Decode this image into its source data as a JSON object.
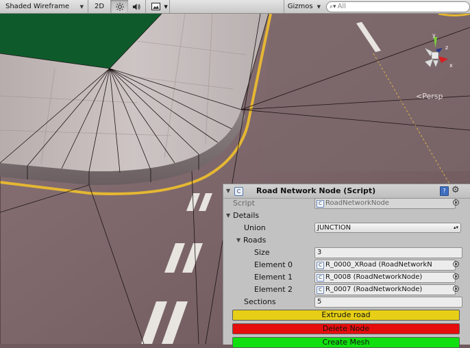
{
  "toolbar": {
    "shading_mode": "Shaded Wireframe",
    "two_d_label": "2D",
    "lighting_icon": "sun-icon",
    "audio_icon": "speaker-icon",
    "effects_icon": "image-icon",
    "gizmos_label": "Gizmos",
    "search_placeholder": "All"
  },
  "scene": {
    "projection_label": "Persp",
    "axis_labels": {
      "y": "y",
      "z": "z",
      "x": "x"
    }
  },
  "component": {
    "title": "Road Network Node (Script)",
    "script_label": "Script",
    "script_value": "RoadNetworkNode",
    "details_label": "Details",
    "union_label": "Union",
    "union_value": "JUNCTION",
    "roads_label": "Roads",
    "size_label": "Size",
    "size_value": "3",
    "elements": [
      {
        "label": "Element 0",
        "value": "R_0000_XRoad (RoadNetworkN"
      },
      {
        "label": "Element 1",
        "value": "R_0008 (RoadNetworkNode)"
      },
      {
        "label": "Element 2",
        "value": "R_0007 (RoadNetworkNode)"
      }
    ],
    "sections_label": "Sections",
    "sections_value": "5",
    "buttons": {
      "extrude": "Extrude road",
      "delete": "Delete Node",
      "create_mesh": "Create Mesh"
    }
  },
  "colors": {
    "extrude_button": "#e6cf16",
    "delete_button": "#e60d0d",
    "create_mesh_button": "#10e010",
    "grass": "#0f5a2b",
    "road_line": "#e5b733"
  }
}
